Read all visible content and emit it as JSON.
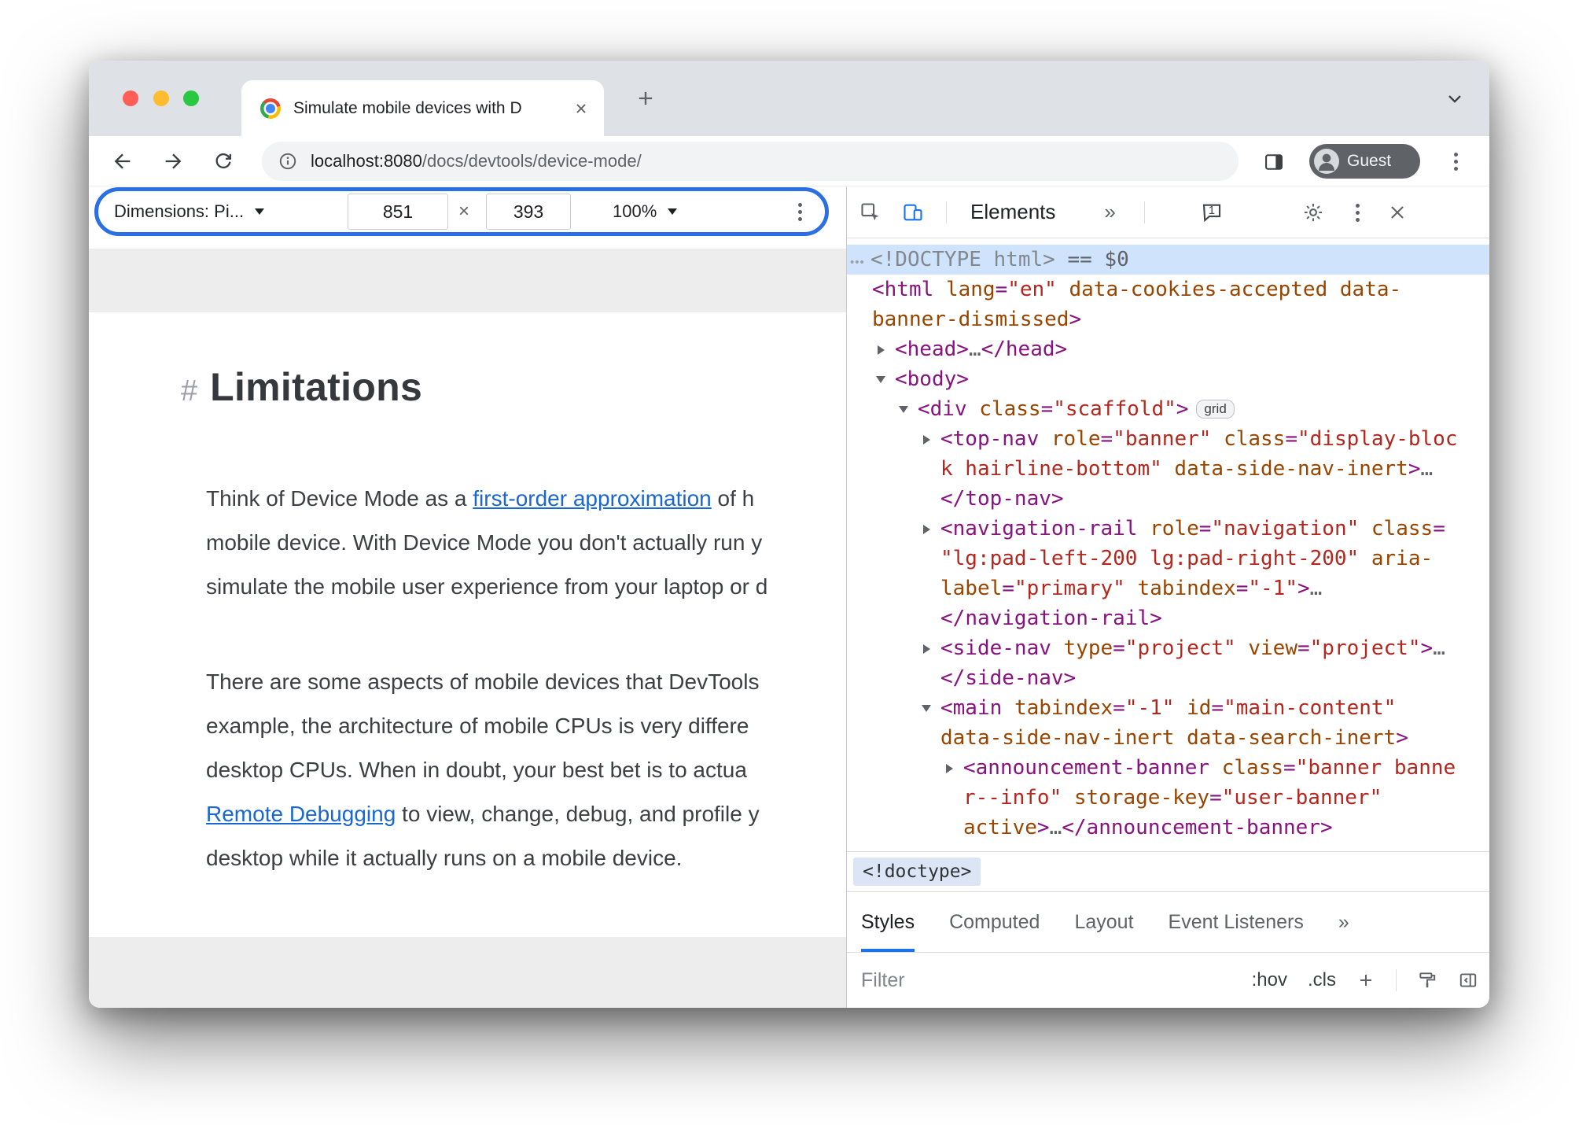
{
  "browser": {
    "tab_title": "Simulate mobile devices with D",
    "url_host": "localhost:8080",
    "url_path": "/docs/devtools/device-mode/",
    "guest_label": "Guest"
  },
  "device_toolbar": {
    "dimensions_label": "Dimensions: Pi...",
    "width_value": "851",
    "times": "×",
    "height_value": "393",
    "zoom_value": "100%"
  },
  "page": {
    "heading_hash": "#",
    "heading": "Limitations",
    "paragraphs": {
      "p1": [
        [
          {
            "t": "text",
            "s": "Think of Device Mode as a "
          },
          {
            "t": "link",
            "s": "first-order approximation"
          },
          {
            "t": "text",
            "s": " of h"
          }
        ],
        [
          {
            "t": "text",
            "s": "mobile device. With Device Mode you don't actually run y"
          }
        ],
        [
          {
            "t": "text",
            "s": "simulate the mobile user experience from your laptop or d"
          }
        ]
      ],
      "p2": [
        [
          {
            "t": "text",
            "s": "There are some aspects of mobile devices that DevTools"
          }
        ],
        [
          {
            "t": "text",
            "s": "example, the architecture of mobile CPUs is very differe"
          }
        ],
        [
          {
            "t": "text",
            "s": "desktop CPUs. When in doubt, your best bet is to actua"
          }
        ],
        [
          {
            "t": "link",
            "s": "Remote Debugging"
          },
          {
            "t": "text",
            "s": " to view, change, debug, and profile y"
          }
        ],
        [
          {
            "t": "text",
            "s": "desktop while it actually runs on a mobile device."
          }
        ]
      ]
    }
  },
  "devtools": {
    "toolbar": {
      "elements_tab": "Elements",
      "more_tabs": "»",
      "console_badge": "1"
    },
    "breadcrumb": "<!doctype>",
    "sidebar_tabs": [
      "Styles",
      "Computed",
      "Layout",
      "Event Listeners"
    ],
    "sidebar_more": "»",
    "filter": {
      "placeholder": "Filter",
      "pseudo": ":hov",
      "classes": ".cls"
    },
    "dom": {
      "lines": [
        {
          "indent": 0,
          "selected": true,
          "arrow": null,
          "segments": [
            {
              "t": "dots",
              "s": "•••"
            },
            {
              "t": "doctype",
              "s": "<!DOCTYPE html>"
            },
            {
              "t": "meta",
              "s": " == $0"
            }
          ]
        },
        {
          "indent": 0,
          "selected": false,
          "arrow": null,
          "segments": [
            {
              "t": "punct",
              "s": "<"
            },
            {
              "t": "tag",
              "s": "html"
            },
            {
              "t": "sp",
              "s": " "
            },
            {
              "t": "attr",
              "s": "lang"
            },
            {
              "t": "punct",
              "s": "="
            },
            {
              "t": "val",
              "s": "\"en\""
            },
            {
              "t": "sp",
              "s": " "
            },
            {
              "t": "attr",
              "s": "data-cookies-accepted"
            },
            {
              "t": "sp",
              "s": " "
            },
            {
              "t": "attr",
              "s": "data-"
            }
          ]
        },
        {
          "indent": 0,
          "selected": false,
          "arrow": null,
          "segments": [
            {
              "t": "attr",
              "s": "banner-dismissed"
            },
            {
              "t": "punct",
              "s": ">"
            }
          ]
        },
        {
          "indent": 1,
          "selected": false,
          "arrow": "right",
          "segments": [
            {
              "t": "punct",
              "s": "<"
            },
            {
              "t": "tag",
              "s": "head"
            },
            {
              "t": "punct",
              "s": ">"
            },
            {
              "t": "ell",
              "s": "…"
            },
            {
              "t": "punct",
              "s": "</"
            },
            {
              "t": "tag",
              "s": "head"
            },
            {
              "t": "punct",
              "s": ">"
            }
          ]
        },
        {
          "indent": 1,
          "selected": false,
          "arrow": "down",
          "segments": [
            {
              "t": "punct",
              "s": "<"
            },
            {
              "t": "tag",
              "s": "body"
            },
            {
              "t": "punct",
              "s": ">"
            }
          ]
        },
        {
          "indent": 2,
          "selected": false,
          "arrow": "down",
          "segments": [
            {
              "t": "punct",
              "s": "<"
            },
            {
              "t": "tag",
              "s": "div"
            },
            {
              "t": "sp",
              "s": " "
            },
            {
              "t": "attr",
              "s": "class"
            },
            {
              "t": "punct",
              "s": "="
            },
            {
              "t": "val",
              "s": "\"scaffold\""
            },
            {
              "t": "punct",
              "s": ">"
            },
            {
              "t": "badge",
              "s": "grid"
            }
          ]
        },
        {
          "indent": 3,
          "selected": false,
          "arrow": "right",
          "segments": [
            {
              "t": "punct",
              "s": "<"
            },
            {
              "t": "tag",
              "s": "top-nav"
            },
            {
              "t": "sp",
              "s": " "
            },
            {
              "t": "attr",
              "s": "role"
            },
            {
              "t": "punct",
              "s": "="
            },
            {
              "t": "val",
              "s": "\"banner\""
            },
            {
              "t": "sp",
              "s": " "
            },
            {
              "t": "attr",
              "s": "class"
            },
            {
              "t": "punct",
              "s": "="
            },
            {
              "t": "val",
              "s": "\"display-bloc"
            }
          ]
        },
        {
          "indent": 3,
          "selected": false,
          "arrow": null,
          "segments": [
            {
              "t": "val",
              "s": "k hairline-bottom\""
            },
            {
              "t": "sp",
              "s": " "
            },
            {
              "t": "attr",
              "s": "data-side-nav-inert"
            },
            {
              "t": "punct",
              "s": ">"
            },
            {
              "t": "ell",
              "s": "…"
            }
          ]
        },
        {
          "indent": 3,
          "selected": false,
          "arrow": null,
          "segments": [
            {
              "t": "punct",
              "s": "</"
            },
            {
              "t": "tag",
              "s": "top-nav"
            },
            {
              "t": "punct",
              "s": ">"
            }
          ]
        },
        {
          "indent": 3,
          "selected": false,
          "arrow": "right",
          "segments": [
            {
              "t": "punct",
              "s": "<"
            },
            {
              "t": "tag",
              "s": "navigation-rail"
            },
            {
              "t": "sp",
              "s": " "
            },
            {
              "t": "attr",
              "s": "role"
            },
            {
              "t": "punct",
              "s": "="
            },
            {
              "t": "val",
              "s": "\"navigation\""
            },
            {
              "t": "sp",
              "s": " "
            },
            {
              "t": "attr",
              "s": "class"
            },
            {
              "t": "punct",
              "s": "="
            }
          ]
        },
        {
          "indent": 3,
          "selected": false,
          "arrow": null,
          "segments": [
            {
              "t": "val",
              "s": "\"lg:pad-left-200 lg:pad-right-200\""
            },
            {
              "t": "sp",
              "s": " "
            },
            {
              "t": "attr",
              "s": "aria-"
            }
          ]
        },
        {
          "indent": 3,
          "selected": false,
          "arrow": null,
          "segments": [
            {
              "t": "attr",
              "s": "label"
            },
            {
              "t": "punct",
              "s": "="
            },
            {
              "t": "val",
              "s": "\"primary\""
            },
            {
              "t": "sp",
              "s": " "
            },
            {
              "t": "attr",
              "s": "tabindex"
            },
            {
              "t": "punct",
              "s": "="
            },
            {
              "t": "val",
              "s": "\"-1\""
            },
            {
              "t": "punct",
              "s": ">"
            },
            {
              "t": "ell",
              "s": "…"
            }
          ]
        },
        {
          "indent": 3,
          "selected": false,
          "arrow": null,
          "segments": [
            {
              "t": "punct",
              "s": "</"
            },
            {
              "t": "tag",
              "s": "navigation-rail"
            },
            {
              "t": "punct",
              "s": ">"
            }
          ]
        },
        {
          "indent": 3,
          "selected": false,
          "arrow": "right",
          "segments": [
            {
              "t": "punct",
              "s": "<"
            },
            {
              "t": "tag",
              "s": "side-nav"
            },
            {
              "t": "sp",
              "s": " "
            },
            {
              "t": "attr",
              "s": "type"
            },
            {
              "t": "punct",
              "s": "="
            },
            {
              "t": "val",
              "s": "\"project\""
            },
            {
              "t": "sp",
              "s": " "
            },
            {
              "t": "attr",
              "s": "view"
            },
            {
              "t": "punct",
              "s": "="
            },
            {
              "t": "val",
              "s": "\"project\""
            },
            {
              "t": "punct",
              "s": ">"
            },
            {
              "t": "ell",
              "s": "…"
            }
          ]
        },
        {
          "indent": 3,
          "selected": false,
          "arrow": null,
          "segments": [
            {
              "t": "punct",
              "s": "</"
            },
            {
              "t": "tag",
              "s": "side-nav"
            },
            {
              "t": "punct",
              "s": ">"
            }
          ]
        },
        {
          "indent": 3,
          "selected": false,
          "arrow": "down",
          "segments": [
            {
              "t": "punct",
              "s": "<"
            },
            {
              "t": "tag",
              "s": "main"
            },
            {
              "t": "sp",
              "s": " "
            },
            {
              "t": "attr",
              "s": "tabindex"
            },
            {
              "t": "punct",
              "s": "="
            },
            {
              "t": "val",
              "s": "\"-1\""
            },
            {
              "t": "sp",
              "s": " "
            },
            {
              "t": "attr",
              "s": "id"
            },
            {
              "t": "punct",
              "s": "="
            },
            {
              "t": "val",
              "s": "\"main-content\""
            }
          ]
        },
        {
          "indent": 3,
          "selected": false,
          "arrow": null,
          "segments": [
            {
              "t": "attr",
              "s": "data-side-nav-inert"
            },
            {
              "t": "sp",
              "s": " "
            },
            {
              "t": "attr",
              "s": "data-search-inert"
            },
            {
              "t": "punct",
              "s": ">"
            }
          ]
        },
        {
          "indent": 4,
          "selected": false,
          "arrow": "right",
          "segments": [
            {
              "t": "punct",
              "s": "<"
            },
            {
              "t": "tag",
              "s": "announcement-banner"
            },
            {
              "t": "sp",
              "s": " "
            },
            {
              "t": "attr",
              "s": "class"
            },
            {
              "t": "punct",
              "s": "="
            },
            {
              "t": "val",
              "s": "\"banner banne"
            }
          ]
        },
        {
          "indent": 4,
          "selected": false,
          "arrow": null,
          "segments": [
            {
              "t": "val",
              "s": "r--info\""
            },
            {
              "t": "sp",
              "s": " "
            },
            {
              "t": "attr",
              "s": "storage-key"
            },
            {
              "t": "punct",
              "s": "="
            },
            {
              "t": "val",
              "s": "\"user-banner\""
            }
          ]
        },
        {
          "indent": 4,
          "selected": false,
          "arrow": null,
          "segments": [
            {
              "t": "attr",
              "s": "active"
            },
            {
              "t": "punct",
              "s": ">"
            },
            {
              "t": "ell",
              "s": "…"
            },
            {
              "t": "punct",
              "s": "</"
            },
            {
              "t": "tag",
              "s": "announcement-banner"
            },
            {
              "t": "punct",
              "s": ">"
            }
          ]
        }
      ]
    }
  },
  "colors": {
    "accent_blue": "#1a73e8",
    "highlight_ring": "#2b6fe4",
    "link": "#1967d2",
    "code_tag": "#881280",
    "code_attribute": "#994500",
    "code_value": "#b3271e"
  }
}
